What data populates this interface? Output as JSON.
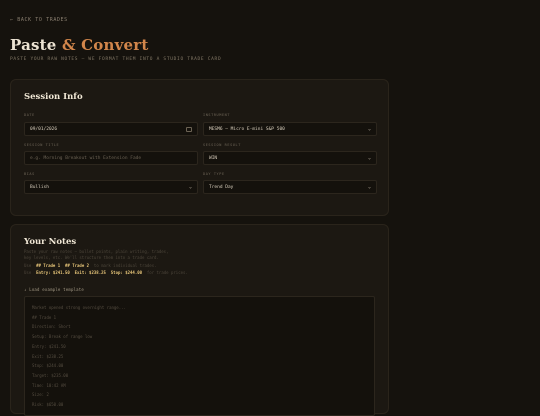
{
  "nav": {
    "back_label": "← BACK TO TRADES"
  },
  "header": {
    "title_main": "Paste",
    "title_amp": "& Convert",
    "subtitle": "PASTE YOUR RAW NOTES — WE FORMAT THEM INTO A STUDIO TRADE CARD"
  },
  "session": {
    "title": "Session Info",
    "date": {
      "label": "DATE",
      "value": "09/01/2026"
    },
    "instrument": {
      "label": "INSTRUMENT",
      "value": "MESM6 — Micro E-mini S&P 500"
    },
    "session_title": {
      "label": "SESSION TITLE",
      "placeholder": "e.g. Morning Breakout with Extension Fade"
    },
    "session_result": {
      "label": "SESSION RESULT",
      "value": "WIN"
    },
    "bias": {
      "label": "BIAS",
      "value": "Bullish"
    },
    "day_type": {
      "label": "DAY TYPE",
      "value": "Trend Day"
    }
  },
  "notes": {
    "title": "Your Notes",
    "help_line1": "Paste your raw notes — bullet points, plain writing, trades,",
    "help_line2": "key levels, etc. We'll structure them into a trade card.",
    "trade_prefix": "Use",
    "trade1": "## Trade 1",
    "trade2": "## Trade 2",
    "trade_suffix": "to mark individual trades.",
    "entries_prefix": "Use",
    "entry": "Entry: $241.50",
    "exit": "Exit: $238.25",
    "stop": "Stop: $244.00",
    "entries_suffix": "for trade prices.",
    "load_label": "↓ Load example template",
    "example_lines": [
      "Market opened strong overnight range...",
      "",
      "## Trade 1",
      "Direction: Short",
      "Setup: Break of range low",
      "Entry: $241.50",
      "Exit: $238.25",
      "Stop: $244.00",
      "Target: $235.00",
      "Time: 10:42 AM",
      "Size: 2",
      "Risk: $650.00"
    ]
  }
}
